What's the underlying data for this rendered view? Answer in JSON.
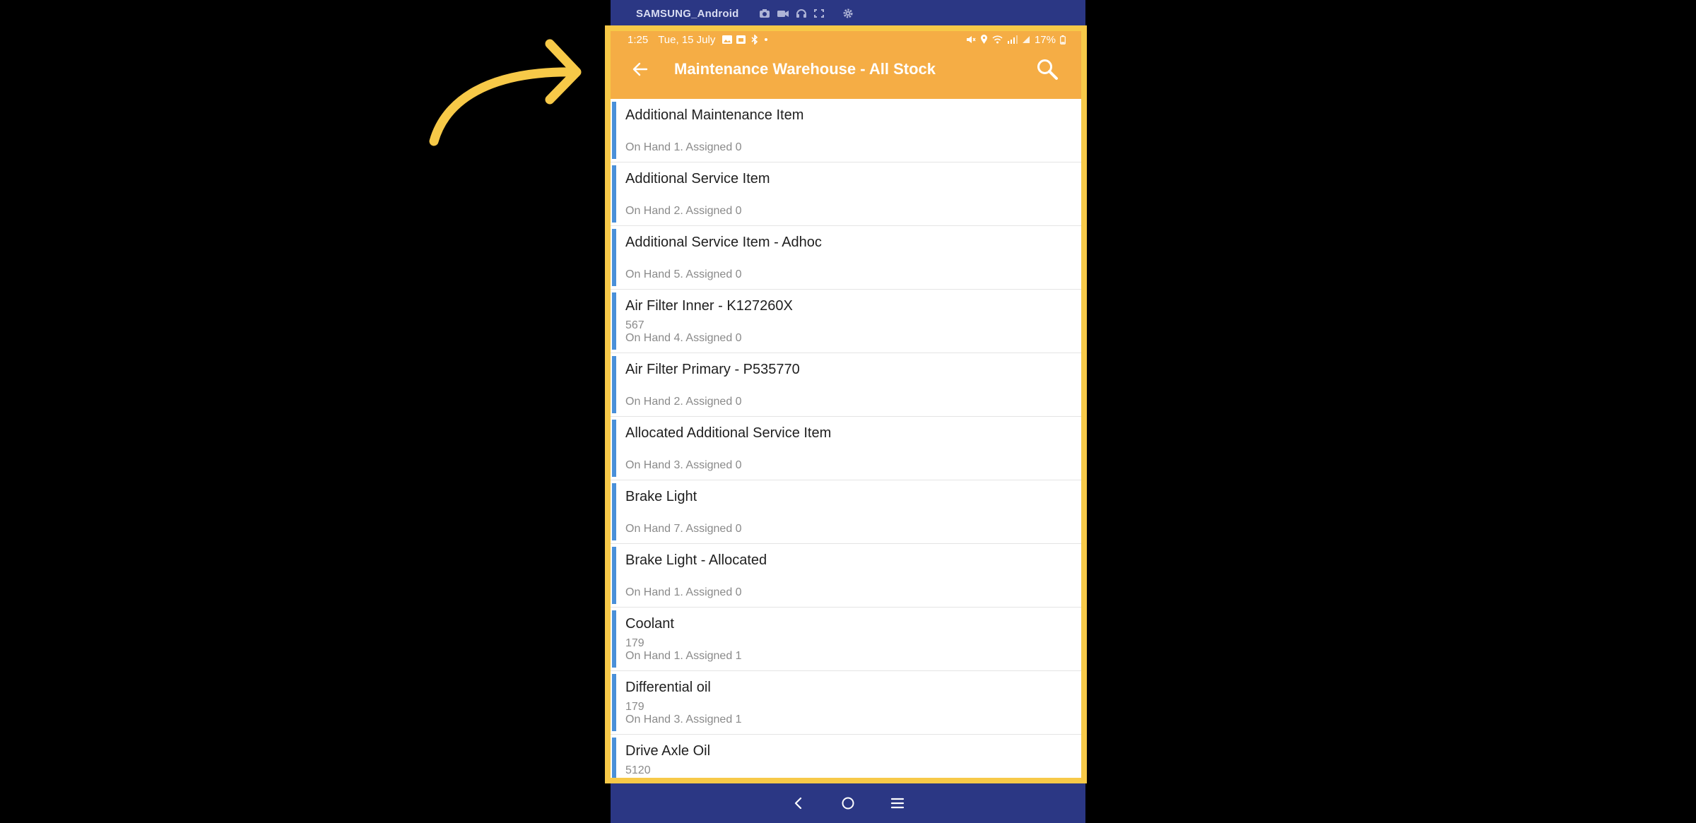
{
  "device": {
    "name": "SAMSUNG_Android",
    "tool_icons": [
      "camera-icon",
      "video-icon",
      "headphones-icon",
      "fullscreen-icon",
      "settings-icon"
    ]
  },
  "status_bar": {
    "time": "1:25",
    "date": "Tue, 15 July",
    "battery": "17%"
  },
  "header": {
    "title": "Maintenance Warehouse - All Stock",
    "background": "#f5ad45"
  },
  "colors": {
    "accent_bar": "#4a90d9",
    "highlight": "#f7c948",
    "frame": "#2b3784"
  },
  "items": [
    {
      "name": "Additional Maintenance Item",
      "code": "",
      "stock": "On Hand 1. Assigned 0"
    },
    {
      "name": "Additional Service Item",
      "code": "",
      "stock": "On Hand 2. Assigned 0"
    },
    {
      "name": "Additional Service Item - Adhoc",
      "code": "",
      "stock": "On Hand 5. Assigned 0"
    },
    {
      "name": "Air Filter Inner - K127260X",
      "code": "567",
      "stock": "On Hand 4. Assigned 0"
    },
    {
      "name": "Air Filter Primary - P535770",
      "code": "",
      "stock": "On Hand 2. Assigned 0"
    },
    {
      "name": "Allocated Additional Service Item",
      "code": "",
      "stock": "On Hand 3. Assigned 0"
    },
    {
      "name": "Brake Light",
      "code": "",
      "stock": "On Hand 7. Assigned 0"
    },
    {
      "name": "Brake Light - Allocated",
      "code": "",
      "stock": "On Hand 1. Assigned 0"
    },
    {
      "name": "Coolant",
      "code": "179",
      "stock": "On Hand 1. Assigned 1"
    },
    {
      "name": "Differential oil",
      "code": "179",
      "stock": "On Hand 3. Assigned 1"
    },
    {
      "name": "Drive Axle Oil",
      "code": "5120",
      "stock": ""
    }
  ]
}
